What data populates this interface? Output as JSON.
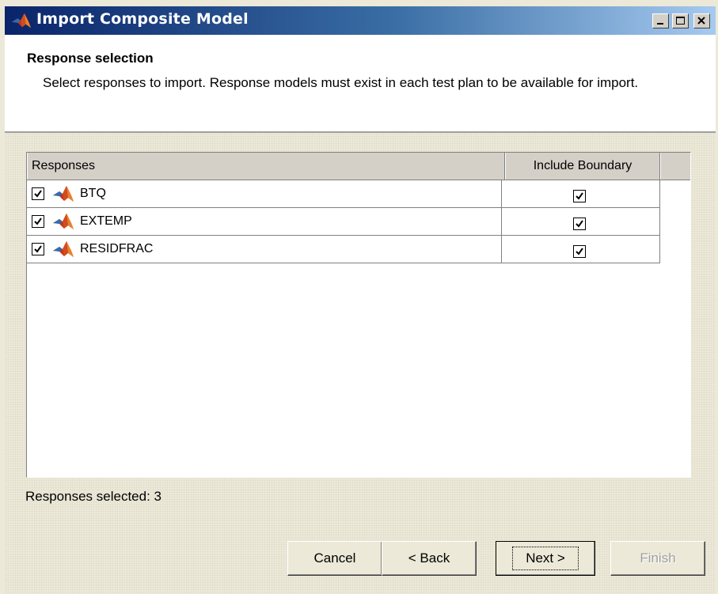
{
  "window": {
    "title": "Import Composite Model",
    "controls": [
      "minimize",
      "maximize",
      "close"
    ],
    "accent": "#0a246a"
  },
  "header": {
    "title": "Response selection",
    "description": "Select responses to import. Response models must exist in each test plan to be available for import."
  },
  "table": {
    "columns": [
      "Responses",
      "Include Boundary"
    ],
    "rows": [
      {
        "name": "BTQ",
        "selected": true,
        "include_boundary": true,
        "icon": "matlab-membrane-icon"
      },
      {
        "name": "EXTEMP",
        "selected": true,
        "include_boundary": true,
        "icon": "matlab-membrane-icon"
      },
      {
        "name": "RESIDFRAC",
        "selected": true,
        "include_boundary": true,
        "icon": "matlab-membrane-icon"
      }
    ]
  },
  "status": "Responses selected: 3",
  "buttons": {
    "cancel": "Cancel",
    "back": "< Back",
    "next": "Next >",
    "finish": "Finish",
    "finish_enabled": false
  }
}
